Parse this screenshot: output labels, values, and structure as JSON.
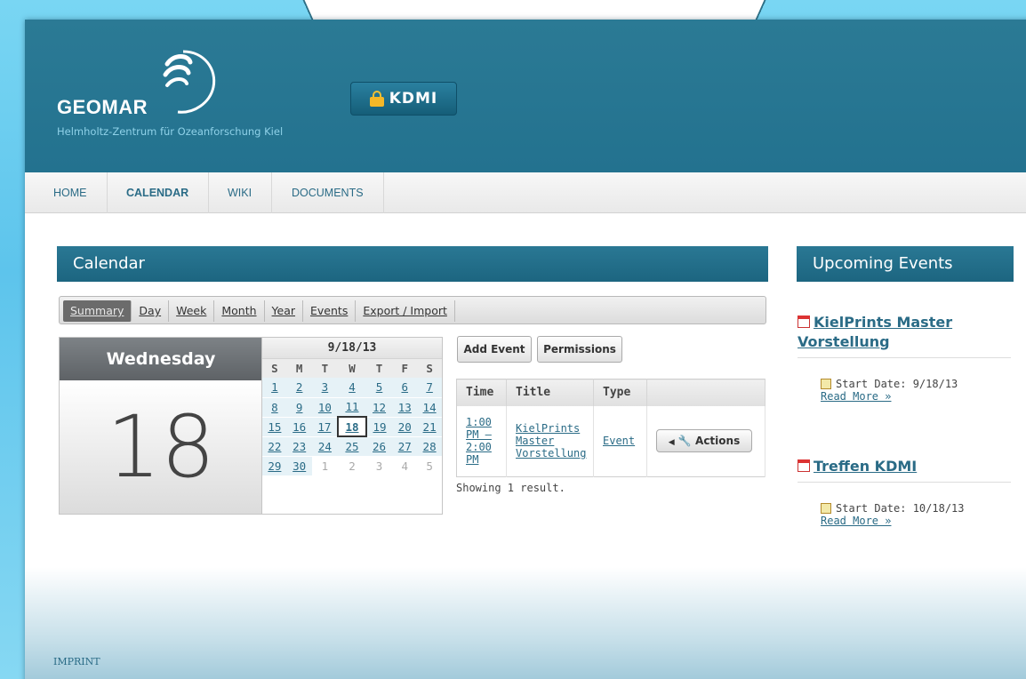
{
  "header": {
    "logo_text": "GEOMAR",
    "logo_subtitle": "Helmholtz-Zentrum für Ozeanforschung Kiel",
    "badge_label": "KDMI"
  },
  "nav": {
    "items": [
      {
        "label": "HOME"
      },
      {
        "label": "CALENDAR"
      },
      {
        "label": "WIKI"
      },
      {
        "label": "DOCUMENTS"
      }
    ]
  },
  "main": {
    "title": "Calendar",
    "tabs": [
      {
        "label": "Summary"
      },
      {
        "label": "Day"
      },
      {
        "label": "Week"
      },
      {
        "label": "Month"
      },
      {
        "label": "Year"
      },
      {
        "label": "Events"
      },
      {
        "label": "Export / Import"
      }
    ],
    "day_name": "Wednesday",
    "day_number": "18",
    "mini_calendar": {
      "title": "9/18/13",
      "weekdays": [
        "S",
        "M",
        "T",
        "W",
        "T",
        "F",
        "S"
      ],
      "weeks": [
        [
          "1",
          "2",
          "3",
          "4",
          "5",
          "6",
          "7"
        ],
        [
          "8",
          "9",
          "10",
          "11",
          "12",
          "13",
          "14"
        ],
        [
          "15",
          "16",
          "17",
          "18",
          "19",
          "20",
          "21"
        ],
        [
          "22",
          "23",
          "24",
          "25",
          "26",
          "27",
          "28"
        ],
        [
          "29",
          "30",
          "1",
          "2",
          "3",
          "4",
          "5"
        ]
      ]
    },
    "buttons": {
      "add_event": "Add Event",
      "permissions": "Permissions",
      "actions": "Actions"
    },
    "events_table": {
      "headers": [
        "Time",
        "Title",
        "Type",
        ""
      ],
      "rows": [
        {
          "time_lines": [
            "1:00",
            "PM –",
            "2:00",
            "PM"
          ],
          "title_lines": [
            "KielPrints",
            "Master",
            "Vorstellung"
          ],
          "type": "Event"
        }
      ]
    },
    "result_text": "Showing 1 result."
  },
  "sidebar": {
    "title": "Upcoming Events",
    "events": [
      {
        "title_line1": "KielPrints Master",
        "title_line2": "Vorstellung",
        "start": "Start Date: 9/18/13",
        "read_more": "Read More »"
      },
      {
        "title_line1": "Treffen KDMI",
        "title_line2": "",
        "start": "Start Date: 10/18/13",
        "read_more": "Read More »"
      }
    ]
  },
  "footer": {
    "imprint": "IMPRINT"
  },
  "colors": {
    "header_bg": "#23728f",
    "link": "#2a6b86",
    "lock": "#f5b827"
  }
}
